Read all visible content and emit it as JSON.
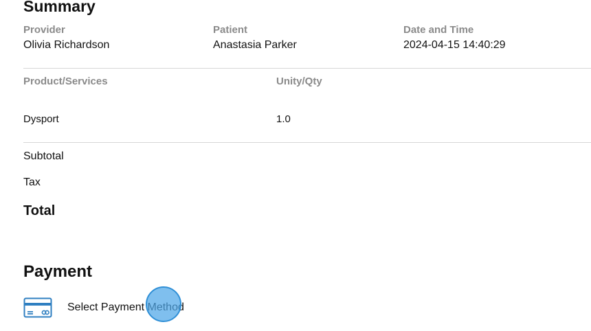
{
  "summary": {
    "title": "Summary",
    "provider_label": "Provider",
    "provider_value": "Olivia Richardson",
    "patient_label": "Patient",
    "patient_value": "Anastasia Parker",
    "datetime_label": "Date and Time",
    "datetime_value": "2024-04-15 14:40:29"
  },
  "table": {
    "headers": [
      "Product/Services",
      "Unity/Qty"
    ],
    "rows": [
      {
        "product": "Dysport",
        "qty": "1.0"
      }
    ]
  },
  "totals": {
    "subtotal_label": "Subtotal",
    "tax_label": "Tax",
    "total_label": "Total"
  },
  "payment": {
    "title": "Payment",
    "select_label": "Select Payment Method",
    "icon": "credit-card-icon",
    "icon_color": "#2f7fc1"
  },
  "colors": {
    "label_gray": "#8a8a8a",
    "divider": "#d6d6d6",
    "click_marker": "#4da6e8"
  }
}
